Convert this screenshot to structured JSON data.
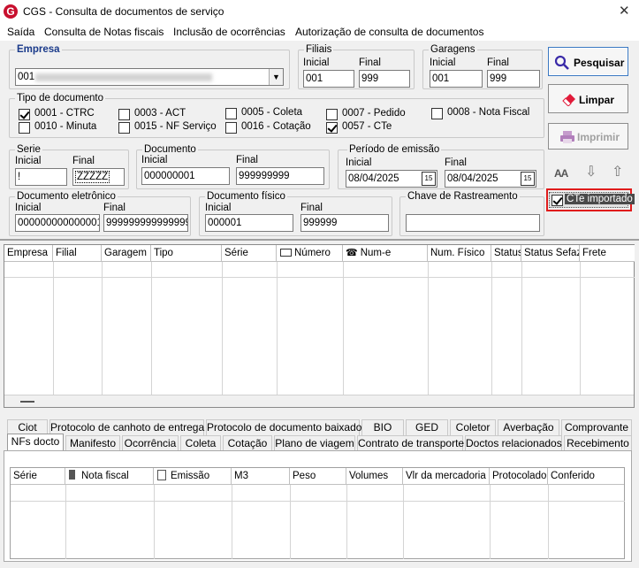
{
  "window": {
    "title": "CGS - Consulta de documentos de serviço",
    "close_icon": "close-icon"
  },
  "menu": [
    {
      "label": "Saída"
    },
    {
      "label": "Consulta de Notas fiscais"
    },
    {
      "label": "Inclusão de ocorrências"
    },
    {
      "label": "Autorização de consulta de documentos"
    }
  ],
  "empresa": {
    "label": "Empresa",
    "value": "001"
  },
  "filiais": {
    "label": "Filiais",
    "inicial_label": "Inicial",
    "final_label": "Final",
    "inicial": "001",
    "final": "999"
  },
  "garagens": {
    "label": "Garagens",
    "inicial_label": "Inicial",
    "final_label": "Final",
    "inicial": "001",
    "final": "999"
  },
  "tipo_documento": {
    "label": "Tipo de documento",
    "items": [
      {
        "label": "0001 - CTRC",
        "checked": true
      },
      {
        "label": "0003 - ACT",
        "checked": false
      },
      {
        "label": "0005 - Coleta",
        "checked": false
      },
      {
        "label": "0007 - Pedido",
        "checked": false
      },
      {
        "label": "0008 - Nota Fiscal",
        "checked": false
      },
      {
        "label": "0010 - Minuta",
        "checked": false
      },
      {
        "label": "0015 - NF Serviço",
        "checked": false
      },
      {
        "label": "0016 - Cotação",
        "checked": false
      },
      {
        "label": "0057 - CTe",
        "checked": true
      }
    ]
  },
  "serie": {
    "label": "Serie",
    "inicial_label": "Inicial",
    "final_label": "Final",
    "inicial": "!",
    "final": "ZZZZZ"
  },
  "documento": {
    "label": "Documento",
    "inicial_label": "Inicial",
    "final_label": "Final",
    "inicial": "000000001",
    "final": "999999999"
  },
  "periodo": {
    "label": "Período de emissão",
    "inicial_label": "Inicial",
    "final_label": "Final",
    "inicial": "08/04/2025",
    "final": "08/04/2025",
    "calendar_icon": "calendar-icon",
    "calendar_glyph": "15"
  },
  "doc_eletronico": {
    "label": "Documento eletrônico",
    "inicial_label": "Inicial",
    "final_label": "Final",
    "inicial": "000000000000001",
    "final": "999999999999999"
  },
  "doc_fisico": {
    "label": "Documento físico",
    "inicial_label": "Inicial",
    "final_label": "Final",
    "inicial": "000001",
    "final": "999999"
  },
  "chave": {
    "label": "Chave de Rastreamento",
    "value": ""
  },
  "buttons": {
    "pesquisar": "Pesquisar",
    "limpar": "Limpar",
    "imprimir": "Imprimir"
  },
  "tools": {
    "font_size_label": "AA"
  },
  "cte_importado": {
    "label": "CTe importado",
    "checked": true
  },
  "main_grid": {
    "columns": [
      "Empresa",
      "Filial",
      "Garagem",
      "Tipo",
      "Série",
      "Número",
      "Num-e",
      "Num. Físico",
      "Status",
      "Status Sefaz",
      "Frete"
    ]
  },
  "tabs_row1": [
    "Ciot",
    "Protocolo de canhoto de entrega",
    "Protocolo de documento baixado",
    "BIO",
    "GED",
    "Coletor",
    "Averbação",
    "Comprovante"
  ],
  "tabs_row2": [
    "NFs docto",
    "Manifesto",
    "Ocorrência",
    "Coleta",
    "Cotação",
    "Plano de viagem",
    "Contrato de transporte",
    "Doctos relacionados",
    "Recebimento"
  ],
  "active_tab": "NFs docto",
  "nf_grid": {
    "columns": [
      "Série",
      "Nota fiscal",
      "Emissão",
      "M3",
      "Peso",
      "Volumes",
      "Vlr da mercadoria",
      "Protocolado",
      "Conferido"
    ]
  }
}
